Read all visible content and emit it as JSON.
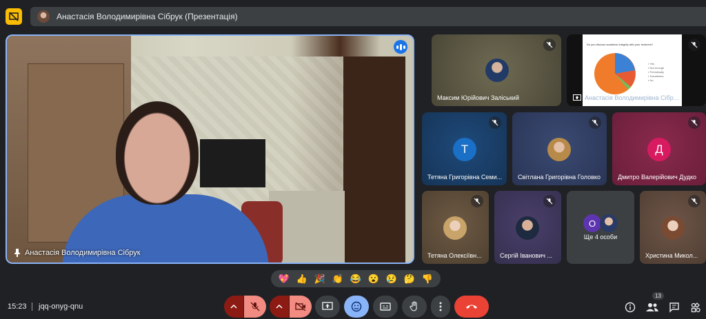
{
  "header": {
    "presenter_chip": "Анастасія Володимирівна Сібрук (Презентація)"
  },
  "main_tile": {
    "name": "Анастасія Володимирівна Сібрук"
  },
  "participants": [
    {
      "name": "Максим Юрійович Заліський"
    },
    {
      "name": "Анастасія Володимирівна Сібрук (Презентація)"
    },
    {
      "name": "Тетяна Григорівна Семи...",
      "letter": "Т"
    },
    {
      "name": "Світлана Григорівна Головко"
    },
    {
      "name": "Дмитро Валерійович Дудко",
      "letter": "Д"
    },
    {
      "name": "Тетяна Олексіївн..."
    },
    {
      "name": "Сергій Іванович ..."
    },
    {
      "name": "Ще 4 особи",
      "letter": "О"
    },
    {
      "name": "Христина Микол..."
    }
  ],
  "reactions": [
    "💖",
    "👍",
    "🎉",
    "👏",
    "😂",
    "😮",
    "😢",
    "🤔",
    "👎"
  ],
  "bottom": {
    "time": "15:23",
    "meeting_code": "jqq-onyg-qnu",
    "people_count": "13"
  },
  "colors": {
    "accent": "#8ab4f8",
    "end_call": "#ea4335",
    "muted_red": "#8c1b13",
    "yellow": "#fbbc04"
  }
}
